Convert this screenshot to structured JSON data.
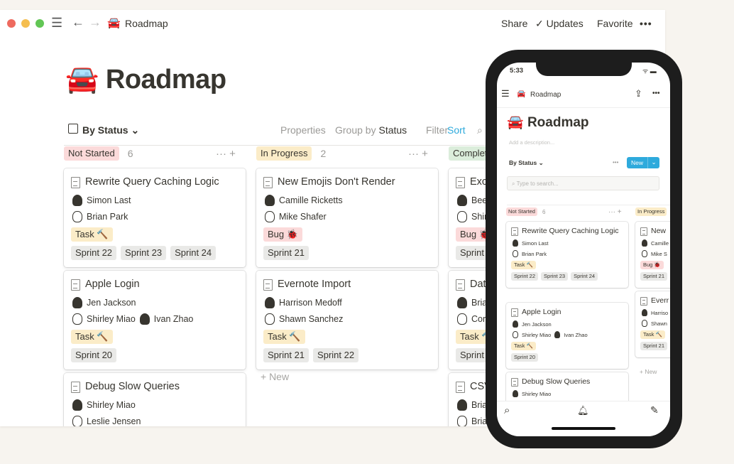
{
  "topbar": {
    "page_icon": "🚘",
    "page_title": "Roadmap",
    "share": "Share",
    "updates": "Updates",
    "favorite": "Favorite",
    "more": "•••"
  },
  "page": {
    "icon": "🚘",
    "title": "Roadmap"
  },
  "view": {
    "name": "By Status",
    "chevron": "⌄",
    "properties": "Properties",
    "group_by_label": "Group by",
    "group_by_value": "Status",
    "filter": "Filter",
    "sort": "Sort"
  },
  "colors": {
    "accent": "#2eaadc",
    "not_started": "#fbdada",
    "in_progress": "#fbecc8",
    "complete": "#dbeddb"
  },
  "columns": [
    {
      "label": "Not Started",
      "count": "6",
      "color": "#fbdada",
      "cards": [
        {
          "title": "Rewrite Query Caching Logic",
          "people": [
            [
              "Simon Last"
            ],
            [
              "Brian Park"
            ]
          ],
          "type": "Task 🔨",
          "type_kind": "task",
          "sprints": [
            "Sprint 22",
            "Sprint 23",
            "Sprint 24"
          ]
        },
        {
          "title": "Apple Login",
          "people": [
            [
              "Jen Jackson"
            ],
            [
              "Shirley Miao",
              "Ivan Zhao"
            ]
          ],
          "type": "Task 🔨",
          "type_kind": "task",
          "sprints": [
            "Sprint 20"
          ]
        },
        {
          "title": "Debug Slow Queries",
          "people": [
            [
              "Shirley Miao"
            ],
            [
              "Leslie Jensen"
            ]
          ],
          "type": "",
          "type_kind": "",
          "sprints": []
        }
      ]
    },
    {
      "label": "In Progress",
      "count": "2",
      "color": "#fbecc8",
      "cards": [
        {
          "title": "New Emojis Don't Render",
          "people": [
            [
              "Camille Ricketts"
            ],
            [
              "Mike Shafer"
            ]
          ],
          "type": "Bug 🐞",
          "type_kind": "bug",
          "sprints": [
            "Sprint 21"
          ]
        },
        {
          "title": "Evernote Import",
          "people": [
            [
              "Harrison Medoff"
            ],
            [
              "Shawn Sanchez"
            ]
          ],
          "type": "Task 🔨",
          "type_kind": "task",
          "sprints": [
            "Sprint 21",
            "Sprint 22"
          ]
        }
      ]
    },
    {
      "label": "Complete",
      "count": "",
      "color": "#dbeddb",
      "cards": [
        {
          "title": "Exc",
          "people": [
            [
              "Bee"
            ],
            [
              "Shir"
            ]
          ],
          "type": "Bug 🐞",
          "type_kind": "bug",
          "sprints": [
            "Sprint 2"
          ]
        },
        {
          "title": "Data",
          "people": [
            [
              "Bria"
            ],
            [
              "Cory"
            ]
          ],
          "type": "Task 🔨",
          "type_kind": "task",
          "sprints": [
            "Sprint 2"
          ]
        },
        {
          "title": "CSV",
          "people": [
            [
              "Bria"
            ],
            [
              "Bria"
            ]
          ],
          "type": "",
          "type_kind": "",
          "sprints": []
        }
      ]
    }
  ],
  "new_label": "+ New",
  "mobile": {
    "time": "5:33",
    "page_icon": "🚘",
    "page_title": "Roadmap",
    "title": "Roadmap",
    "description_placeholder": "Add a description...",
    "view": "By Status ⌄",
    "more": "•••",
    "new_button": "New",
    "new_chevron": "⌄",
    "search_placeholder": "Type to search...",
    "columns": [
      {
        "label": "Not Started",
        "count": "6",
        "color": "#fbdada",
        "cards": [
          {
            "title": "Rewrite Query Caching Logic",
            "people": [
              [
                "Simon Last"
              ],
              [
                "Brian Park"
              ]
            ],
            "type": "Task 🔨",
            "type_kind": "task",
            "sprints": [
              "Sprint 22",
              "Sprint 23",
              "Sprint 24"
            ]
          },
          {
            "title": "Apple Login",
            "people": [
              [
                "Jen Jackson"
              ],
              [
                "Shirley Miao",
                "Ivan Zhao"
              ]
            ],
            "type": "Task 🔨",
            "type_kind": "task",
            "sprints": [
              "Sprint 20"
            ]
          },
          {
            "title": "Debug Slow Queries",
            "people": [
              [
                "Shirley Miao"
              ]
            ],
            "type": "",
            "type_kind": "",
            "sprints": []
          }
        ]
      },
      {
        "label": "In Progress",
        "count": "",
        "color": "#fbecc8",
        "cards": [
          {
            "title": "New",
            "people": [
              [
                "Camille"
              ],
              [
                "Mike S"
              ]
            ],
            "type": "Bug 🐞",
            "type_kind": "bug",
            "sprints": [
              "Sprint 21"
            ]
          },
          {
            "title": "Everr",
            "people": [
              [
                "Harriso"
              ],
              [
                "Shawn"
              ]
            ],
            "type": "Task 🔨",
            "type_kind": "task",
            "sprints": [
              "Sprint 21"
            ]
          }
        ]
      }
    ],
    "new_label": "+ New"
  }
}
